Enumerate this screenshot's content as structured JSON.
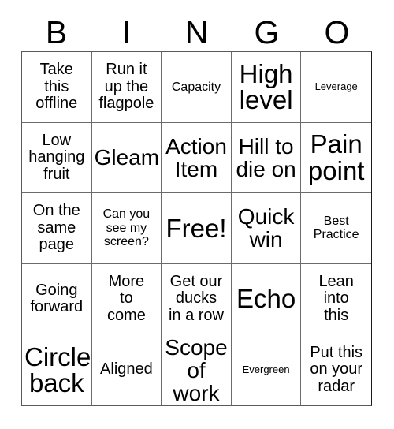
{
  "card": {
    "title": "BINGO",
    "header_letters": [
      "B",
      "I",
      "N",
      "G",
      "O"
    ],
    "rows": 5,
    "columns": 5,
    "free_space_label": "Free!",
    "free_space_position": "center",
    "colors": {
      "background": "#ffffff",
      "text": "#000000",
      "grid_line": "#6b6b6b",
      "outer_border": "#5a5a5a"
    },
    "cells": [
      {
        "text": "Take\nthis\noffline",
        "size": "m"
      },
      {
        "text": "Run it\nup the\nflagpole",
        "size": "m"
      },
      {
        "text": "Capacity",
        "size": "s"
      },
      {
        "text": "High\nlevel",
        "size": "xxl"
      },
      {
        "text": "Leverage",
        "size": "xs"
      },
      {
        "text": "Low\nhanging\nfruit",
        "size": "m"
      },
      {
        "text": "Gleam",
        "size": "xl"
      },
      {
        "text": "Action\nItem",
        "size": "xl"
      },
      {
        "text": "Hill to\ndie on",
        "size": "xl"
      },
      {
        "text": "Pain\npoint",
        "size": "xxl"
      },
      {
        "text": "On the\nsame\npage",
        "size": "m"
      },
      {
        "text": "Can you\nsee my\nscreen?",
        "size": "s"
      },
      {
        "text": "Free!",
        "size": "xxl"
      },
      {
        "text": "Quick\nwin",
        "size": "xl"
      },
      {
        "text": "Best\nPractice",
        "size": "s"
      },
      {
        "text": "Going\nforward",
        "size": "m"
      },
      {
        "text": "More\nto\ncome",
        "size": "m"
      },
      {
        "text": "Get our\nducks\nin a row",
        "size": "m"
      },
      {
        "text": "Echo",
        "size": "xxl"
      },
      {
        "text": "Lean\ninto\nthis",
        "size": "m"
      },
      {
        "text": "Circle\nback",
        "size": "xxl"
      },
      {
        "text": "Aligned",
        "size": "m"
      },
      {
        "text": "Scope\nof work",
        "size": "xl"
      },
      {
        "text": "Evergreen",
        "size": "xs"
      },
      {
        "text": "Put this\non your\nradar",
        "size": "m"
      }
    ]
  }
}
